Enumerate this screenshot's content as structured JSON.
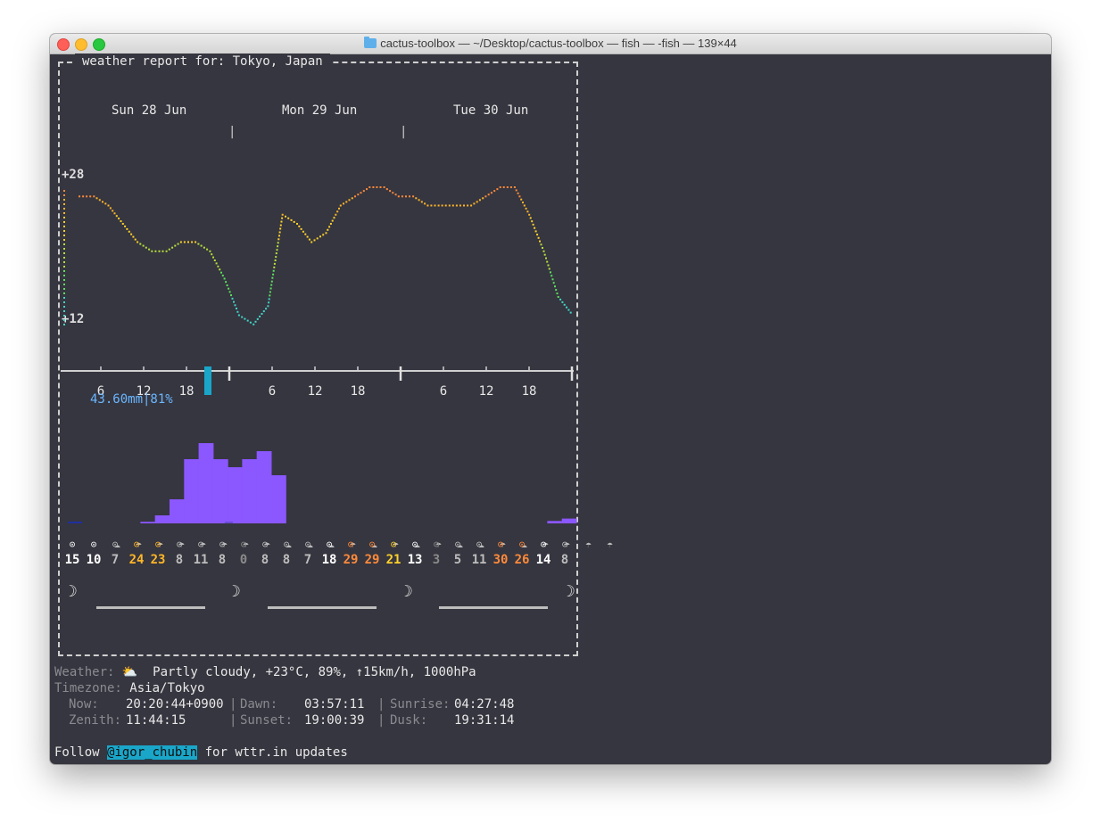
{
  "window": {
    "title": "cactus-toolbox — ~/Desktop/cactus-toolbox — fish — -fish — 139×44"
  },
  "report": {
    "header": "weather report for: Tokyo, Japan",
    "days": [
      "Sun 28 Jun",
      "Mon 29 Jun",
      "Tue 30 Jun"
    ],
    "temp_max_label": "+28",
    "temp_min_label": "+12",
    "hour_labels": [
      "6",
      "12",
      "18",
      "6",
      "12",
      "18",
      "6",
      "12",
      "18"
    ],
    "precip_label": "43.60mm|81%",
    "temperature_series": [
      27,
      27,
      26,
      24,
      22,
      21,
      21,
      22,
      22,
      21,
      18,
      14,
      13,
      15,
      25,
      24,
      22,
      23,
      26,
      27,
      28,
      28,
      27,
      27,
      26,
      26,
      26,
      26,
      27,
      28,
      28,
      25,
      21,
      16,
      14
    ],
    "precipitation_series": [
      0,
      0,
      0,
      0,
      0,
      0.2,
      1,
      3,
      8,
      10,
      8,
      7,
      8,
      9,
      6,
      0,
      0,
      0,
      0,
      0,
      0,
      0,
      0,
      0,
      0,
      0,
      0,
      0,
      0,
      0,
      0,
      0,
      0,
      0.3,
      0.6
    ],
    "wind_speeds": [
      "15",
      "10",
      "7",
      "24",
      "23",
      "8",
      "11",
      "8",
      "0",
      "8",
      "8",
      "7",
      "18",
      "29",
      "29",
      "21",
      "13",
      "3",
      "5",
      "11",
      "30",
      "26",
      "14",
      "8"
    ],
    "wind_colors": [
      "#ffffff",
      "#ffffff",
      "#bdbdbd",
      "#ffb627",
      "#ffb627",
      "#bdbdbd",
      "#bdbdbd",
      "#bdbdbd",
      "#8a8a8a",
      "#bdbdbd",
      "#bdbdbd",
      "#bdbdbd",
      "#ffffff",
      "#ff8a3a",
      "#ff8a3a",
      "#ffd12a",
      "#ffffff",
      "#8a8a8a",
      "#bdbdbd",
      "#bdbdbd",
      "#ff8a3a",
      "#ff8a3a",
      "#ffffff",
      "#bdbdbd"
    ],
    "moon_icon": "moon-crescent-icon",
    "colors": {
      "purple": "#8b57ff",
      "cyan": "#19a6c9",
      "orange": "#ff8a3a",
      "yellow": "#ffd12a",
      "green": "#5be05b"
    }
  },
  "summary": {
    "weather_label": "Weather:",
    "weather_value": "Partly cloudy, +23°C, 89%, ↑15km/h, 1000hPa",
    "weather_icon": "partly-cloudy-icon",
    "timezone_label": "Timezone:",
    "timezone_value": "Asia/Tokyo",
    "now_label": "Now:",
    "now_value": "20:20:44+0900",
    "dawn_label": "Dawn:",
    "dawn_value": "03:57:11",
    "sunrise_label": "Sunrise:",
    "sunrise_value": "04:27:48",
    "zenith_label": "Zenith:",
    "zenith_value": "11:44:15",
    "sunset_label": "Sunset:",
    "sunset_value": "19:00:39",
    "dusk_label": "Dusk:",
    "dusk_value": "19:31:14"
  },
  "footer": {
    "prefix": "Follow",
    "handle": "@igor_chubin",
    "suffix": "for wttr.in updates"
  }
}
